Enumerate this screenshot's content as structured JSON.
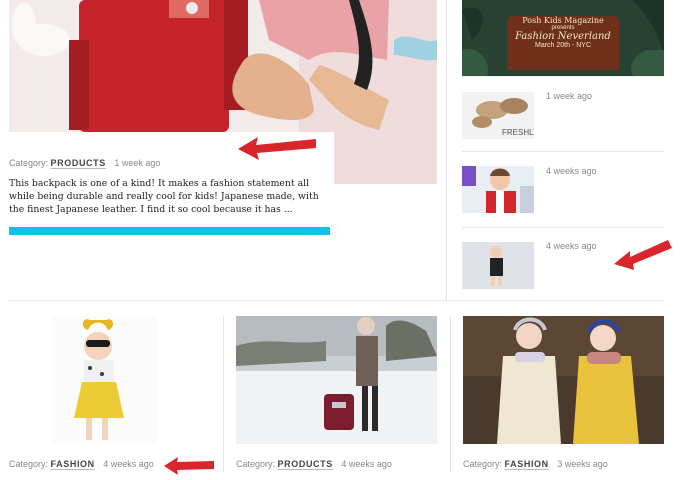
{
  "featured": {
    "category_label": "Category:",
    "category": "PRODUCTS",
    "time_ago": "1 week ago",
    "excerpt": "This backpack is one of a kind! It makes a fashion statement all while being durable and really cool for kids! Japanese made, with the finest Japanese leather. I find it so cool because it has ..."
  },
  "sidebar": {
    "ad": {
      "line1": "Posh Kids Magazine",
      "line2": "presents",
      "line3": "Fashion Neverland",
      "line4": "March 20th - NYC"
    },
    "items": [
      {
        "time_ago": "1 week ago",
        "thumb_text": "FRESHLY"
      },
      {
        "time_ago": "4 weeks ago"
      },
      {
        "time_ago": "4 weeks ago"
      }
    ]
  },
  "cards": [
    {
      "category_label": "Category:",
      "category": "FASHION",
      "time_ago": "4 weeks ago"
    },
    {
      "category_label": "Category:",
      "category": "PRODUCTS",
      "time_ago": "4 weeks ago"
    },
    {
      "category_label": "Category:",
      "category": "FASHION",
      "time_ago": "3 weeks ago"
    }
  ],
  "colors": {
    "accent_bar": "#12c0ea",
    "arrow": "#d9262a"
  }
}
